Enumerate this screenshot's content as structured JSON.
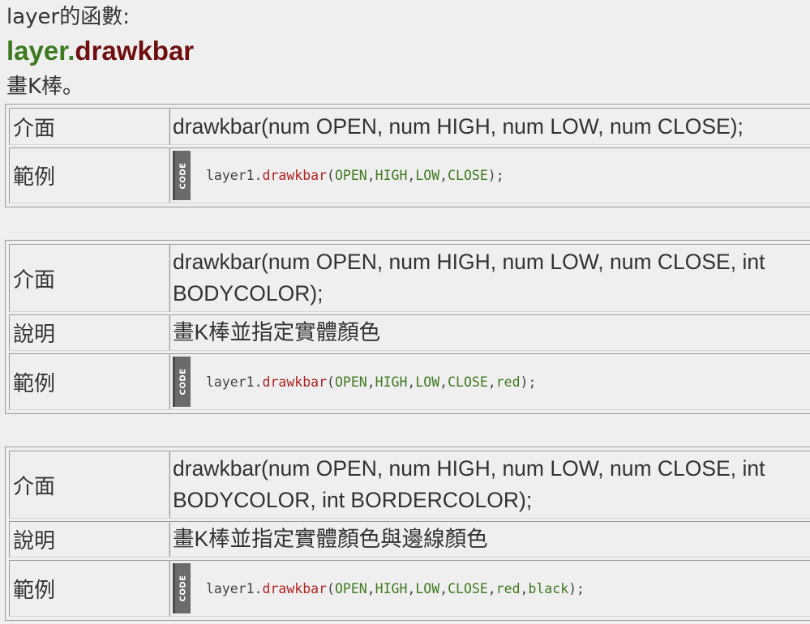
{
  "header": {
    "text": "layer的函數:"
  },
  "function": {
    "object": "layer.",
    "name": "drawkbar",
    "description": "畫K棒。"
  },
  "labels": {
    "interface": "介面",
    "explain": "說明",
    "example": "範例",
    "code_tag": "CODE"
  },
  "colors": {
    "object_green": "#3d7a1f",
    "function_darkred": "#6e0e0e",
    "code_function_red": "#b22222"
  },
  "overloads": [
    {
      "interface_line1": "drawkbar(num OPEN, num HIGH, num LOW, num CLOSE);",
      "example": {
        "object": "layer1.",
        "function": "drawkbar",
        "open_paren": "(",
        "args": [
          "OPEN",
          "HIGH",
          "LOW",
          "CLOSE"
        ],
        "close": ");"
      }
    },
    {
      "interface_line1": "drawkbar(num OPEN, num HIGH, num LOW, num CLOSE, int",
      "interface_line2": "BODYCOLOR);",
      "explain": "畫K棒並指定實體顏色",
      "example": {
        "object": "layer1.",
        "function": "drawkbar",
        "open_paren": "(",
        "args": [
          "OPEN",
          "HIGH",
          "LOW",
          "CLOSE",
          "red"
        ],
        "close": ");"
      }
    },
    {
      "interface_line1": "drawkbar(num OPEN, num HIGH, num LOW, num CLOSE, int",
      "interface_line2": "BODYCOLOR, int BORDERCOLOR);",
      "explain": "畫K棒並指定實體顏色與邊線顏色",
      "example": {
        "object": "layer1.",
        "function": "drawkbar",
        "open_paren": "(",
        "args": [
          "OPEN",
          "HIGH",
          "LOW",
          "CLOSE",
          "red",
          "black"
        ],
        "close": ");"
      }
    }
  ]
}
